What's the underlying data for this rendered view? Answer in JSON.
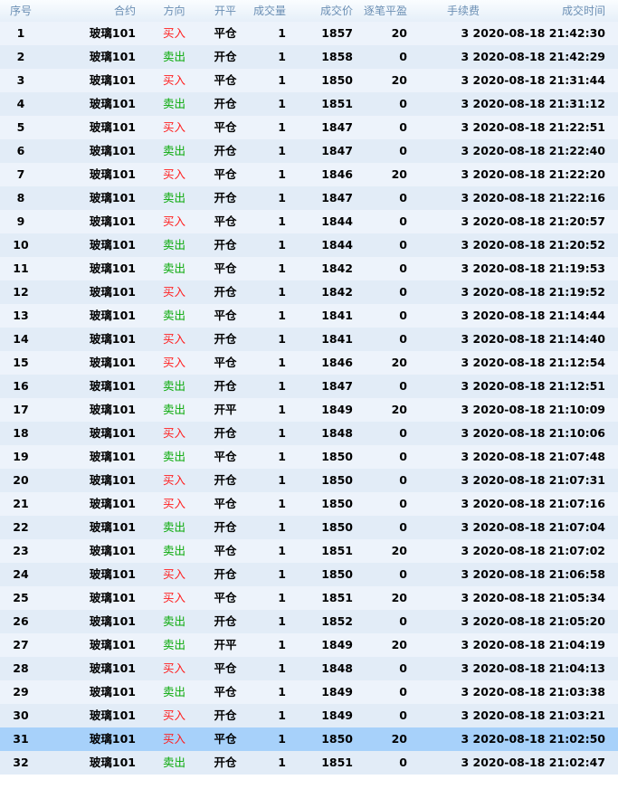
{
  "headers": [
    "序号",
    "合约",
    "方向",
    "开平",
    "成交量",
    "成交价",
    "逐笔平盈",
    "手续费",
    "成交时间"
  ],
  "colors": {
    "buy": "#ff1f1f",
    "sell": "#0aaa0a",
    "selected_row": "#a7d1fa"
  },
  "selected_index": 30,
  "rows": [
    {
      "no": "1",
      "contract": "玻璃101",
      "dir": "买入",
      "oc": "平仓",
      "vol": "1",
      "price": "1857",
      "pnl": "20",
      "fee": "3",
      "time": "2020-08-18 21:42:30"
    },
    {
      "no": "2",
      "contract": "玻璃101",
      "dir": "卖出",
      "oc": "开仓",
      "vol": "1",
      "price": "1858",
      "pnl": "0",
      "fee": "3",
      "time": "2020-08-18 21:42:29"
    },
    {
      "no": "3",
      "contract": "玻璃101",
      "dir": "买入",
      "oc": "平仓",
      "vol": "1",
      "price": "1850",
      "pnl": "20",
      "fee": "3",
      "time": "2020-08-18 21:31:44"
    },
    {
      "no": "4",
      "contract": "玻璃101",
      "dir": "卖出",
      "oc": "开仓",
      "vol": "1",
      "price": "1851",
      "pnl": "0",
      "fee": "3",
      "time": "2020-08-18 21:31:12"
    },
    {
      "no": "5",
      "contract": "玻璃101",
      "dir": "买入",
      "oc": "平仓",
      "vol": "1",
      "price": "1847",
      "pnl": "0",
      "fee": "3",
      "time": "2020-08-18 21:22:51"
    },
    {
      "no": "6",
      "contract": "玻璃101",
      "dir": "卖出",
      "oc": "开仓",
      "vol": "1",
      "price": "1847",
      "pnl": "0",
      "fee": "3",
      "time": "2020-08-18 21:22:40"
    },
    {
      "no": "7",
      "contract": "玻璃101",
      "dir": "买入",
      "oc": "平仓",
      "vol": "1",
      "price": "1846",
      "pnl": "20",
      "fee": "3",
      "time": "2020-08-18 21:22:20"
    },
    {
      "no": "8",
      "contract": "玻璃101",
      "dir": "卖出",
      "oc": "开仓",
      "vol": "1",
      "price": "1847",
      "pnl": "0",
      "fee": "3",
      "time": "2020-08-18 21:22:16"
    },
    {
      "no": "9",
      "contract": "玻璃101",
      "dir": "买入",
      "oc": "平仓",
      "vol": "1",
      "price": "1844",
      "pnl": "0",
      "fee": "3",
      "time": "2020-08-18 21:20:57"
    },
    {
      "no": "10",
      "contract": "玻璃101",
      "dir": "卖出",
      "oc": "开仓",
      "vol": "1",
      "price": "1844",
      "pnl": "0",
      "fee": "3",
      "time": "2020-08-18 21:20:52"
    },
    {
      "no": "11",
      "contract": "玻璃101",
      "dir": "卖出",
      "oc": "平仓",
      "vol": "1",
      "price": "1842",
      "pnl": "0",
      "fee": "3",
      "time": "2020-08-18 21:19:53"
    },
    {
      "no": "12",
      "contract": "玻璃101",
      "dir": "买入",
      "oc": "开仓",
      "vol": "1",
      "price": "1842",
      "pnl": "0",
      "fee": "3",
      "time": "2020-08-18 21:19:52"
    },
    {
      "no": "13",
      "contract": "玻璃101",
      "dir": "卖出",
      "oc": "平仓",
      "vol": "1",
      "price": "1841",
      "pnl": "0",
      "fee": "3",
      "time": "2020-08-18 21:14:44"
    },
    {
      "no": "14",
      "contract": "玻璃101",
      "dir": "买入",
      "oc": "开仓",
      "vol": "1",
      "price": "1841",
      "pnl": "0",
      "fee": "3",
      "time": "2020-08-18 21:14:40"
    },
    {
      "no": "15",
      "contract": "玻璃101",
      "dir": "买入",
      "oc": "平仓",
      "vol": "1",
      "price": "1846",
      "pnl": "20",
      "fee": "3",
      "time": "2020-08-18 21:12:54"
    },
    {
      "no": "16",
      "contract": "玻璃101",
      "dir": "卖出",
      "oc": "开仓",
      "vol": "1",
      "price": "1847",
      "pnl": "0",
      "fee": "3",
      "time": "2020-08-18 21:12:51"
    },
    {
      "no": "17",
      "contract": "玻璃101",
      "dir": "卖出",
      "oc": "开平",
      "vol": "1",
      "price": "1849",
      "pnl": "20",
      "fee": "3",
      "time": "2020-08-18 21:10:09"
    },
    {
      "no": "18",
      "contract": "玻璃101",
      "dir": "买入",
      "oc": "开仓",
      "vol": "1",
      "price": "1848",
      "pnl": "0",
      "fee": "3",
      "time": "2020-08-18 21:10:06"
    },
    {
      "no": "19",
      "contract": "玻璃101",
      "dir": "卖出",
      "oc": "平仓",
      "vol": "1",
      "price": "1850",
      "pnl": "0",
      "fee": "3",
      "time": "2020-08-18 21:07:48"
    },
    {
      "no": "20",
      "contract": "玻璃101",
      "dir": "买入",
      "oc": "开仓",
      "vol": "1",
      "price": "1850",
      "pnl": "0",
      "fee": "3",
      "time": "2020-08-18 21:07:31"
    },
    {
      "no": "21",
      "contract": "玻璃101",
      "dir": "买入",
      "oc": "平仓",
      "vol": "1",
      "price": "1850",
      "pnl": "0",
      "fee": "3",
      "time": "2020-08-18 21:07:16"
    },
    {
      "no": "22",
      "contract": "玻璃101",
      "dir": "卖出",
      "oc": "开仓",
      "vol": "1",
      "price": "1850",
      "pnl": "0",
      "fee": "3",
      "time": "2020-08-18 21:07:04"
    },
    {
      "no": "23",
      "contract": "玻璃101",
      "dir": "卖出",
      "oc": "平仓",
      "vol": "1",
      "price": "1851",
      "pnl": "20",
      "fee": "3",
      "time": "2020-08-18 21:07:02"
    },
    {
      "no": "24",
      "contract": "玻璃101",
      "dir": "买入",
      "oc": "开仓",
      "vol": "1",
      "price": "1850",
      "pnl": "0",
      "fee": "3",
      "time": "2020-08-18 21:06:58"
    },
    {
      "no": "25",
      "contract": "玻璃101",
      "dir": "买入",
      "oc": "平仓",
      "vol": "1",
      "price": "1851",
      "pnl": "20",
      "fee": "3",
      "time": "2020-08-18 21:05:34"
    },
    {
      "no": "26",
      "contract": "玻璃101",
      "dir": "卖出",
      "oc": "开仓",
      "vol": "1",
      "price": "1852",
      "pnl": "0",
      "fee": "3",
      "time": "2020-08-18 21:05:20"
    },
    {
      "no": "27",
      "contract": "玻璃101",
      "dir": "卖出",
      "oc": "开平",
      "vol": "1",
      "price": "1849",
      "pnl": "20",
      "fee": "3",
      "time": "2020-08-18 21:04:19"
    },
    {
      "no": "28",
      "contract": "玻璃101",
      "dir": "买入",
      "oc": "平仓",
      "vol": "1",
      "price": "1848",
      "pnl": "0",
      "fee": "3",
      "time": "2020-08-18 21:04:13"
    },
    {
      "no": "29",
      "contract": "玻璃101",
      "dir": "卖出",
      "oc": "平仓",
      "vol": "1",
      "price": "1849",
      "pnl": "0",
      "fee": "3",
      "time": "2020-08-18 21:03:38"
    },
    {
      "no": "30",
      "contract": "玻璃101",
      "dir": "买入",
      "oc": "开仓",
      "vol": "1",
      "price": "1849",
      "pnl": "0",
      "fee": "3",
      "time": "2020-08-18 21:03:21"
    },
    {
      "no": "31",
      "contract": "玻璃101",
      "dir": "买入",
      "oc": "平仓",
      "vol": "1",
      "price": "1850",
      "pnl": "20",
      "fee": "3",
      "time": "2020-08-18 21:02:50"
    },
    {
      "no": "32",
      "contract": "玻璃101",
      "dir": "卖出",
      "oc": "开仓",
      "vol": "1",
      "price": "1851",
      "pnl": "0",
      "fee": "3",
      "time": "2020-08-18 21:02:47"
    }
  ]
}
